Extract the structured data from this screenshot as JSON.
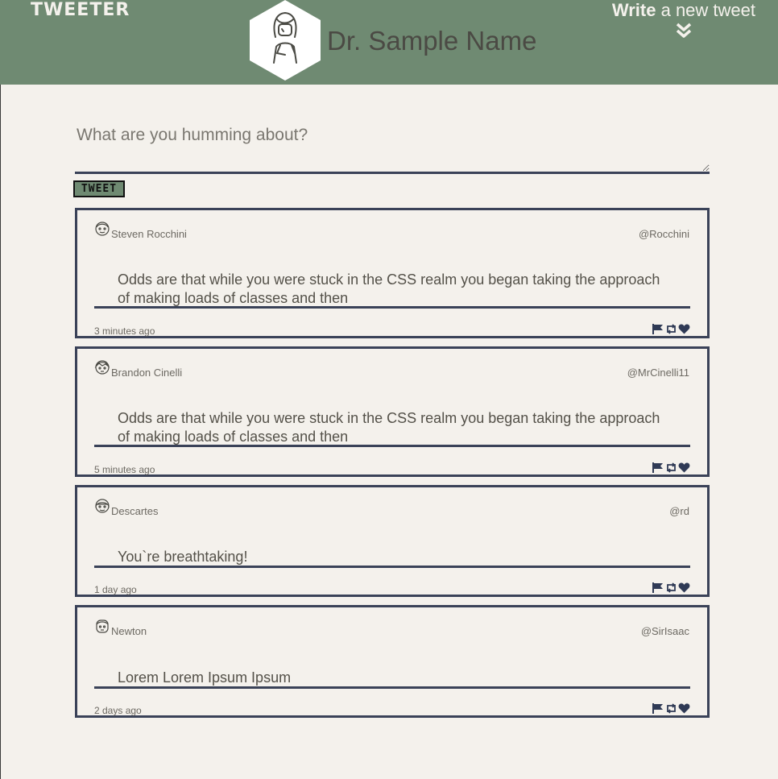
{
  "header": {
    "brand": "TWEETER",
    "profile_name": "Dr. Sample Name",
    "compose_strong": "Write",
    "compose_rest": " a new tweet",
    "colors": {
      "bar": "#6f8a72",
      "text": "#f4f1ec",
      "border": "#3a4258"
    }
  },
  "composer": {
    "placeholder": "What are you humming about?",
    "button_label": "TWEET"
  },
  "tweets": [
    {
      "name": "Steven Rocchini",
      "handle": "@Rocchini",
      "text": "Odds are that while you were stuck in the CSS realm you began taking the approach of making loads of classes and then",
      "time": "3 minutes ago"
    },
    {
      "name": "Brandon Cinelli",
      "handle": "@MrCinelli11",
      "text": "Odds are that while you were stuck in the CSS realm you began taking the approach of making loads of classes and then",
      "time": "5 minutes ago"
    },
    {
      "name": "Descartes",
      "handle": "@rd",
      "text": "You`re breathtaking!",
      "time": "1 day ago"
    },
    {
      "name": "Newton",
      "handle": "@SirIsaac",
      "text": "Lorem Lorem Ipsum Ipsum",
      "time": "2 days ago"
    }
  ],
  "icons": [
    "flag-icon",
    "retweet-icon",
    "heart-icon",
    "chevron-double-down-icon"
  ]
}
